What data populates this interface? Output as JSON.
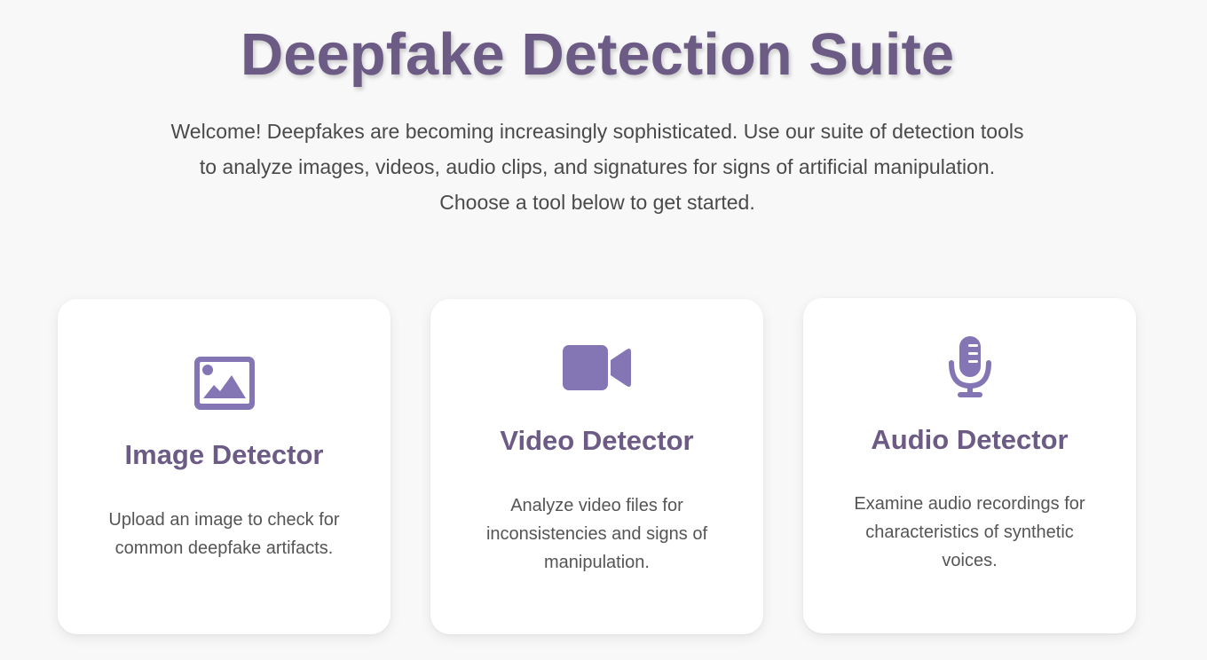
{
  "header": {
    "title": "Deepfake Detection Suite",
    "intro_line1": "Welcome! Deepfakes are becoming increasingly sophisticated. Use our suite of detection tools",
    "intro_line2": "to analyze images, videos, audio clips, and signatures for signs of artificial manipulation.",
    "intro_line3": "Choose a tool below to get started."
  },
  "colors": {
    "accent": "#6b5b85",
    "icon": "#8475b5",
    "background": "#f8f8f8",
    "card": "#ffffff"
  },
  "cards": [
    {
      "icon": "image-icon",
      "title": "Image Detector",
      "description": "Upload an image to check for common deepfake artifacts."
    },
    {
      "icon": "video-camera-icon",
      "title": "Video Detector",
      "description": "Analyze video files for inconsistencies and signs of manipulation."
    },
    {
      "icon": "microphone-icon",
      "title": "Audio Detector",
      "description": "Examine audio recordings for characteristics of synthetic voices."
    }
  ]
}
